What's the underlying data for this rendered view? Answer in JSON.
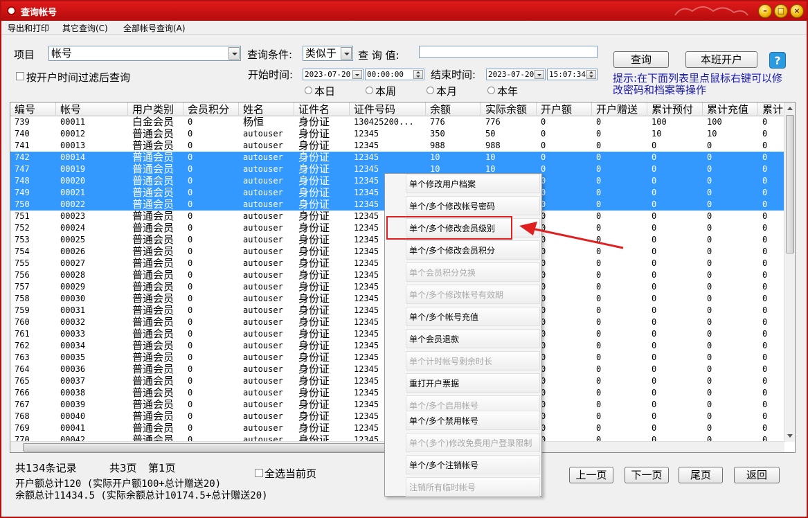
{
  "window": {
    "title": "查询帐号"
  },
  "menu": [
    "导出和打印",
    "其它查询(C)",
    "全部帐号查询(A)"
  ],
  "query": {
    "item_label": "项目",
    "item_value": "帐号",
    "condition_label": "查询条件:",
    "condition_value": "类似于",
    "value_label": "查 询 值:",
    "filter_checkbox_label": "按开户时间过滤后查询",
    "start_label": "开始时间:",
    "start_date": "2023-07-20",
    "start_time": "00:00:00",
    "end_label": "结束时间:",
    "end_date": "2023-07-20",
    "end_time": "15:07:34",
    "radios": [
      "本日",
      "本周",
      "本月",
      "本年"
    ],
    "query_button": "查询",
    "open_account_button": "本班开户",
    "help": "?",
    "hint_line1": "提示:在下面列表里点鼠标右键可以修",
    "hint_line2": "改密码和档案等操作"
  },
  "table": {
    "columns": [
      "编号",
      "帐号",
      "用户类别",
      "会员积分",
      "姓名",
      "证件名",
      "证件号码",
      "余额",
      "实际余额",
      "开户额",
      "开户赠送",
      "累计预付",
      "累计充值",
      "累计"
    ],
    "rows": [
      [
        "739",
        "00011",
        "白金会员",
        "0",
        "杨恒",
        "身份证",
        "130425200...",
        "776",
        "776",
        "0",
        "0",
        "100",
        "100",
        "0"
      ],
      [
        "740",
        "00012",
        "普通会员",
        "0",
        "autouser",
        "身份证",
        "12345",
        "350",
        "50",
        "0",
        "0",
        "10",
        "10",
        "0"
      ],
      [
        "741",
        "00013",
        "普通会员",
        "0",
        "autouser",
        "身份证",
        "12345",
        "988",
        "988",
        "0",
        "0",
        "0",
        "0",
        "0"
      ],
      [
        "742",
        "00014",
        "普通会员",
        "0",
        "autouser",
        "身份证",
        "12345",
        "10",
        "10",
        "0",
        "0",
        "0",
        "0",
        "0"
      ],
      [
        "747",
        "00019",
        "普通会员",
        "0",
        "autouser",
        "身份证",
        "12345",
        "10",
        "10",
        "0",
        "0",
        "0",
        "0",
        "0"
      ],
      [
        "748",
        "00020",
        "普通会员",
        "0",
        "autouser",
        "身份证",
        "12345",
        "",
        "",
        "0",
        "0",
        "0",
        "0",
        "0"
      ],
      [
        "749",
        "00021",
        "普通会员",
        "0",
        "autouser",
        "身份证",
        "12345",
        "",
        "",
        "0",
        "0",
        "0",
        "0",
        "0"
      ],
      [
        "750",
        "00022",
        "普通会员",
        "0",
        "autouser",
        "身份证",
        "12345",
        "",
        "",
        "0",
        "0",
        "0",
        "0",
        "0"
      ],
      [
        "751",
        "00023",
        "普通会员",
        "0",
        "autouser",
        "身份证",
        "12345",
        "",
        "",
        "0",
        "0",
        "0",
        "0",
        "0"
      ],
      [
        "752",
        "00024",
        "普通会员",
        "0",
        "autouser",
        "身份证",
        "12345",
        "",
        "",
        "0",
        "0",
        "0",
        "0",
        "0"
      ],
      [
        "753",
        "00025",
        "普通会员",
        "0",
        "autouser",
        "身份证",
        "12345",
        "",
        "",
        "0",
        "0",
        "0",
        "0",
        "0"
      ],
      [
        "754",
        "00026",
        "普通会员",
        "0",
        "autouser",
        "身份证",
        "12345",
        "",
        "",
        "0",
        "0",
        "0",
        "0",
        "0"
      ],
      [
        "755",
        "00027",
        "普通会员",
        "0",
        "autouser",
        "身份证",
        "12345",
        "",
        "",
        "0",
        "0",
        "0",
        "0",
        "0"
      ],
      [
        "756",
        "00028",
        "普通会员",
        "0",
        "autouser",
        "身份证",
        "12345",
        "",
        "",
        "0",
        "0",
        "0",
        "0",
        "0"
      ],
      [
        "757",
        "00029",
        "普通会员",
        "0",
        "autouser",
        "身份证",
        "12345",
        "",
        "",
        "0",
        "0",
        "0",
        "0",
        "0"
      ],
      [
        "758",
        "00030",
        "普通会员",
        "0",
        "autouser",
        "身份证",
        "12345",
        "",
        "",
        "0",
        "0",
        "0",
        "0",
        "0"
      ],
      [
        "759",
        "00031",
        "普通会员",
        "0",
        "autouser",
        "身份证",
        "12345",
        "",
        "",
        "0",
        "0",
        "0",
        "0",
        "0"
      ],
      [
        "760",
        "00032",
        "普通会员",
        "0",
        "autouser",
        "身份证",
        "12345",
        "",
        "",
        "0",
        "0",
        "0",
        "0",
        "0"
      ],
      [
        "761",
        "00033",
        "普通会员",
        "0",
        "autouser",
        "身份证",
        "12345",
        "",
        "",
        "0",
        "0",
        "0",
        "0",
        "0"
      ],
      [
        "762",
        "00034",
        "普通会员",
        "0",
        "autouser",
        "身份证",
        "12345",
        "",
        "",
        "0",
        "0",
        "0",
        "0",
        "0"
      ],
      [
        "763",
        "00035",
        "普通会员",
        "0",
        "autouser",
        "身份证",
        "12345",
        "",
        "",
        "0",
        "0",
        "0",
        "0",
        "0"
      ],
      [
        "764",
        "00036",
        "普通会员",
        "0",
        "autouser",
        "身份证",
        "12345",
        "",
        "",
        "0",
        "0",
        "0",
        "0",
        "0"
      ],
      [
        "765",
        "00037",
        "普通会员",
        "0",
        "autouser",
        "身份证",
        "12345",
        "",
        "",
        "0",
        "0",
        "0",
        "0",
        "0"
      ],
      [
        "766",
        "00038",
        "普通会员",
        "0",
        "autouser",
        "身份证",
        "12345",
        "",
        "",
        "0",
        "0",
        "0",
        "0",
        "0"
      ],
      [
        "767",
        "00039",
        "普通会员",
        "0",
        "autouser",
        "身份证",
        "12345",
        "",
        "",
        "0",
        "0",
        "0",
        "0",
        "0"
      ],
      [
        "768",
        "00040",
        "普通会员",
        "0",
        "autouser",
        "身份证",
        "12345",
        "",
        "",
        "0",
        "0",
        "0",
        "0",
        "0"
      ],
      [
        "769",
        "00041",
        "普通会员",
        "0",
        "autouser",
        "身份证",
        "12345",
        "",
        "",
        "0",
        "0",
        "0",
        "0",
        "0"
      ],
      [
        "770",
        "00042",
        "普通会员",
        "0",
        "autouser",
        "身份证",
        "12345",
        "",
        "",
        "0",
        "0",
        "0",
        "0",
        "0"
      ]
    ],
    "selected_rows": [
      3,
      4,
      5,
      6,
      7
    ]
  },
  "footer": {
    "records": "共134条记录",
    "pages": "共3页",
    "current_page": "第1页",
    "select_all": "全选当前页",
    "summary1": "开户额总计120 (实际开户额100+总计赠送20)",
    "summary2": "余额总计11434.5 (实际余额总计10174.5+总计赠送20)",
    "prev_button": "上一页",
    "next_button": "下一页",
    "last_button": "尾页",
    "back_button": "返回"
  },
  "context_menu": [
    {
      "label": "单个修改用户档案",
      "enabled": true
    },
    {
      "label": "单个/多个修改帐号密码",
      "enabled": true
    },
    {
      "label": "单个/多个修改会员级别",
      "enabled": true
    },
    {
      "label": "单个/多个修改会员积分",
      "enabled": true
    },
    {
      "label": "单个会员积分兑换",
      "enabled": false
    },
    {
      "label": "单个/多个修改帐号有效期",
      "enabled": false
    },
    {
      "label": "单个/多个帐号充值",
      "enabled": true
    },
    {
      "label": "单个会员退款",
      "enabled": true
    },
    {
      "label": "单个计时帐号剩余时长",
      "enabled": false
    },
    {
      "label": "重打开户票据",
      "enabled": true
    },
    {
      "label": "单个/多个启用帐号",
      "enabled": false
    },
    {
      "label": "单个/多个禁用帐号",
      "enabled": true
    },
    {
      "label": "单个(多个)修改免费用户登录限制",
      "enabled": false
    },
    {
      "label": "单个/多个注销帐号",
      "enabled": true
    },
    {
      "label": "注销所有临时帐号",
      "enabled": false
    }
  ],
  "colors": {
    "selection": "#3399ff",
    "title_red": "#c81010",
    "annotation_red": "#e02020",
    "hint_blue": "#1a1ab0"
  }
}
